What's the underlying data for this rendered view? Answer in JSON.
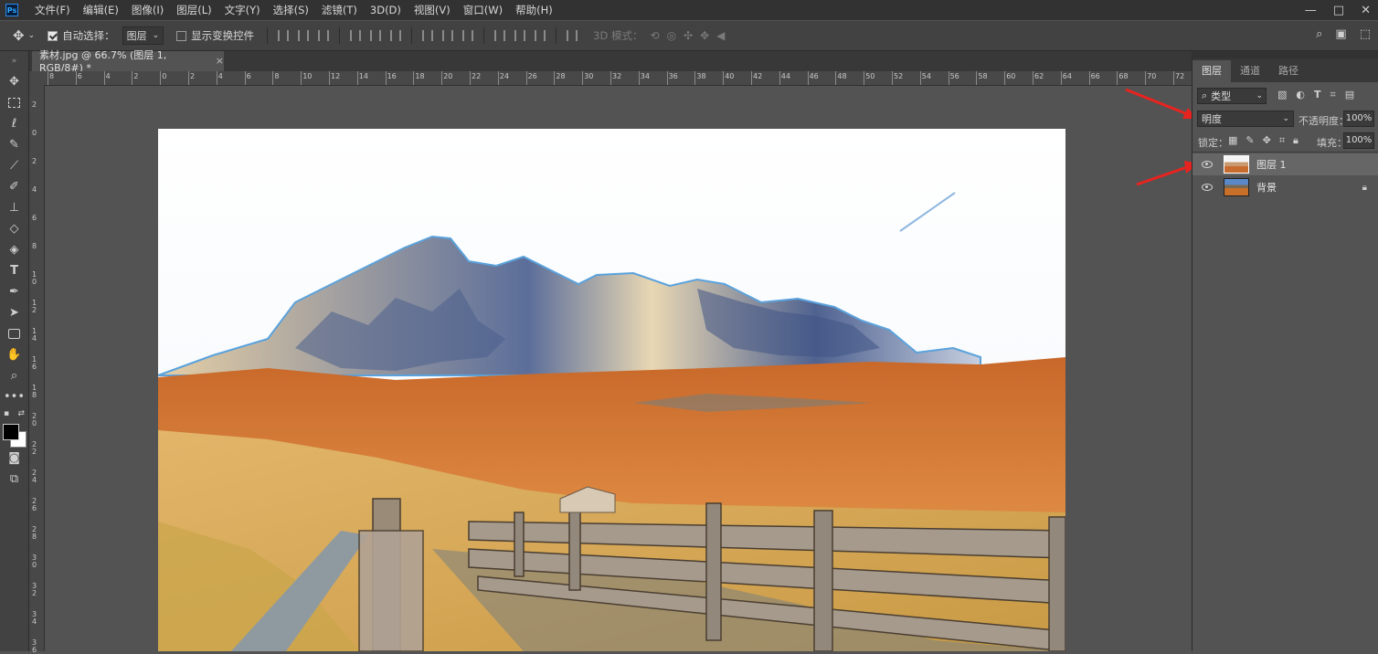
{
  "app": {
    "logo": "Ps"
  },
  "menu": [
    "文件(F)",
    "编辑(E)",
    "图像(I)",
    "图层(L)",
    "文字(Y)",
    "选择(S)",
    "滤镜(T)",
    "3D(D)",
    "视图(V)",
    "窗口(W)",
    "帮助(H)"
  ],
  "window_controls": {
    "minimize": "—",
    "restore": "□",
    "close": "✕"
  },
  "options": {
    "auto_select_label": "自动选择：",
    "auto_select_target": "图层",
    "show_transform_label": "显示变换控件",
    "mode_3d_label": "3D 模式："
  },
  "document": {
    "tab_title": "素材.jpg @ 66.7% (图层 1, RGB/8#) *",
    "tab_close": "×"
  },
  "rulers": {
    "h_labels": [
      "8",
      "6",
      "4",
      "2",
      "0",
      "2",
      "4",
      "6",
      "8",
      "10",
      "12",
      "14",
      "16",
      "18",
      "20",
      "22",
      "24",
      "26",
      "28",
      "30",
      "32",
      "34",
      "36",
      "38",
      "40",
      "42",
      "44",
      "46",
      "48",
      "50",
      "52",
      "54",
      "56",
      "58",
      "60",
      "62",
      "64",
      "66",
      "68",
      "70",
      "72"
    ],
    "v_labels": [
      "2",
      "0",
      "2",
      "4",
      "6",
      "8",
      "1\n0",
      "1\n2",
      "1\n4",
      "1\n6",
      "1\n8",
      "2\n0",
      "2\n2",
      "2\n4",
      "2\n6",
      "2\n8",
      "3\n0",
      "3\n2",
      "3\n4",
      "3\n6"
    ]
  },
  "panel": {
    "tabs": [
      "图层",
      "通道",
      "路径"
    ],
    "filter_kind": "类型",
    "blend_mode": "明度",
    "opacity_label": "不透明度：",
    "opacity_value": "100%",
    "lock_label": "锁定：",
    "fill_label": "填充：",
    "fill_value": "100%",
    "layers": [
      {
        "name": "图层 1",
        "selected": true,
        "locked": false
      },
      {
        "name": "背景",
        "selected": false,
        "locked": true
      }
    ]
  },
  "colors": {
    "annotation_arrow": "#e8231f",
    "accent": "#31a8ff"
  }
}
